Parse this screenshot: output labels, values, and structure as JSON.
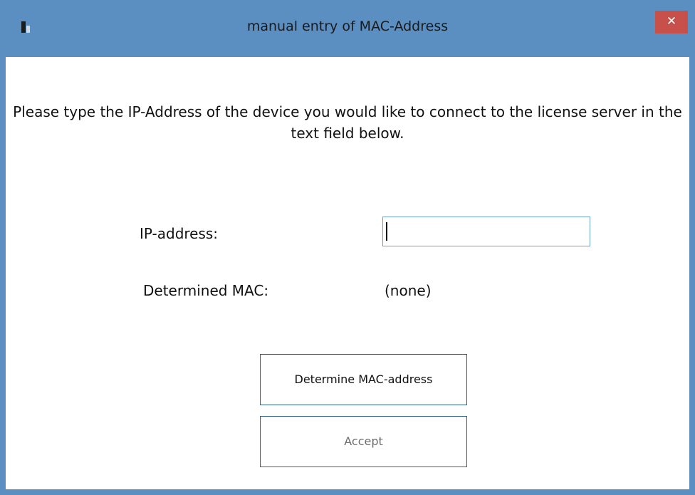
{
  "window": {
    "title": "manual entry of MAC-Address",
    "close_glyph": "✕",
    "app_icon": "app-icon",
    "colors": {
      "titlebar": "#5b8fc1",
      "close": "#c7504b"
    }
  },
  "content": {
    "instructions": "Please type the IP-Address of the device you would like to connect to the license server in the text field below.",
    "ip_label": "IP-address:",
    "ip_value": "",
    "mac_label": "Determined MAC:",
    "mac_value": "(none)",
    "determine_button": "Determine MAC-address",
    "accept_button": "Accept"
  }
}
